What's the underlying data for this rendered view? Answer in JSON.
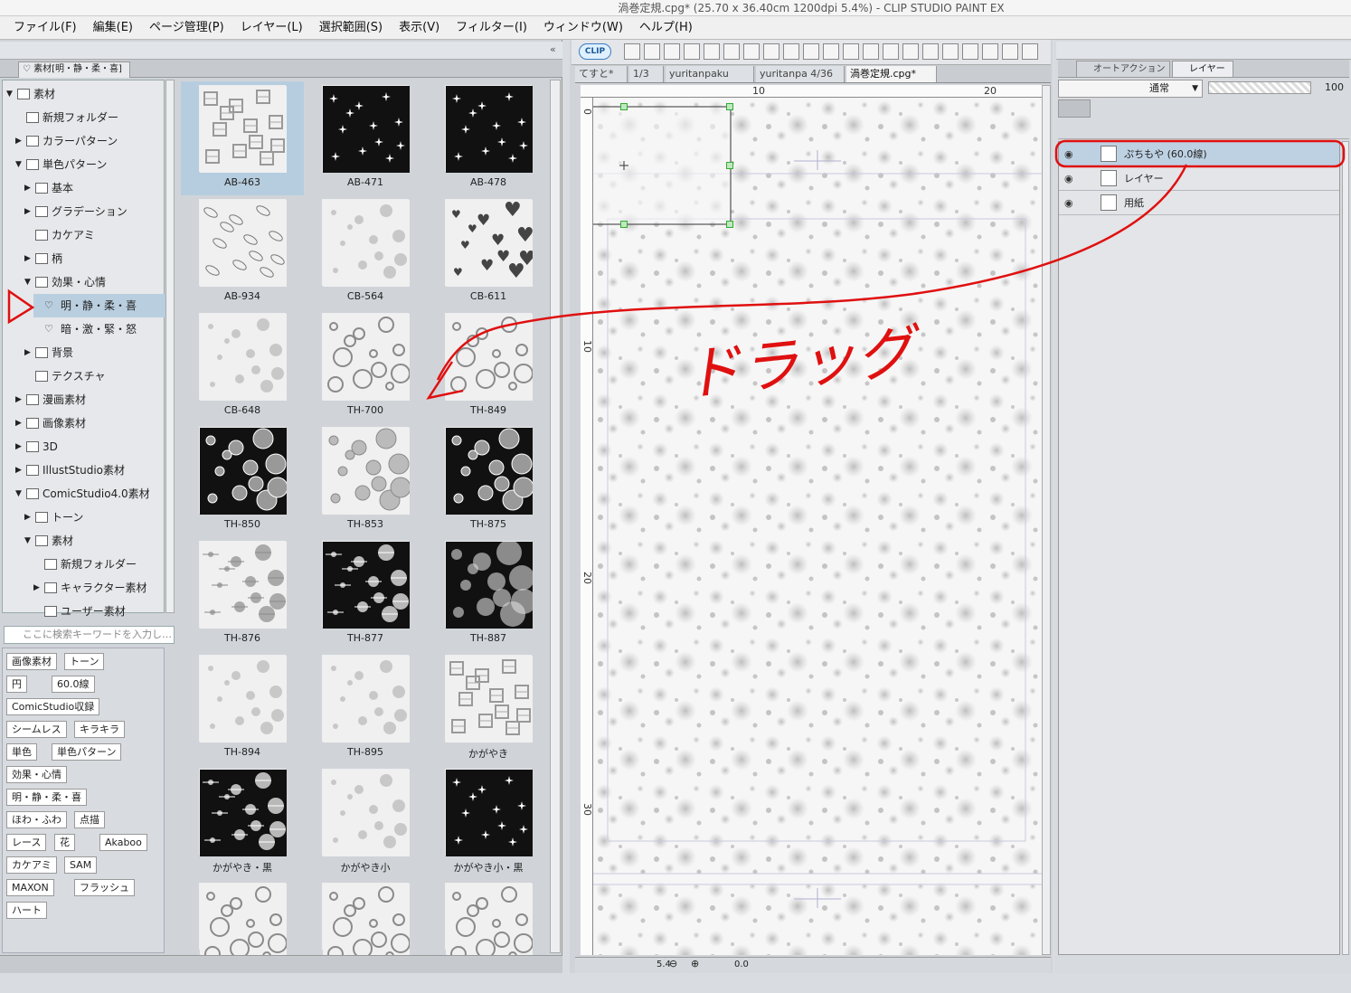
{
  "window": {
    "title": "渦巻定規.cpg* (25.70 x 36.40cm 1200dpi 5.4%)  - CLIP STUDIO PAINT EX"
  },
  "menu": [
    "ファイル(F)",
    "編集(E)",
    "ページ管理(P)",
    "レイヤー(L)",
    "選択範囲(S)",
    "表示(V)",
    "フィルター(I)",
    "ウィンドウ(W)",
    "ヘルプ(H)"
  ],
  "material_panel": {
    "tab_label": "素材[明・静・柔・喜]",
    "tree": [
      {
        "label": "素材",
        "level": 0,
        "arrow": "▼"
      },
      {
        "label": "新規フォルダー",
        "level": 1,
        "arrow": ""
      },
      {
        "label": "カラーパターン",
        "level": 1,
        "arrow": "▶"
      },
      {
        "label": "単色パターン",
        "level": 1,
        "arrow": "▼"
      },
      {
        "label": "基本",
        "level": 2,
        "arrow": "▶"
      },
      {
        "label": "グラデーション",
        "level": 2,
        "arrow": "▶"
      },
      {
        "label": "カケアミ",
        "level": 2,
        "arrow": ""
      },
      {
        "label": "柄",
        "level": 2,
        "arrow": "▶"
      },
      {
        "label": "効果・心情",
        "level": 2,
        "arrow": "▼"
      },
      {
        "label": "明・静・柔・喜",
        "level": 3,
        "arrow": "",
        "selected": true
      },
      {
        "label": "暗・激・緊・怒",
        "level": 3,
        "arrow": ""
      },
      {
        "label": "背景",
        "level": 2,
        "arrow": "▶"
      },
      {
        "label": "テクスチャ",
        "level": 2,
        "arrow": ""
      },
      {
        "label": "漫画素材",
        "level": 1,
        "arrow": "▶"
      },
      {
        "label": "画像素材",
        "level": 1,
        "arrow": "▶"
      },
      {
        "label": "3D",
        "level": 1,
        "arrow": "▶"
      },
      {
        "label": "IllustStudio素材",
        "level": 1,
        "arrow": "▶"
      },
      {
        "label": "ComicStudio4.0素材",
        "level": 1,
        "arrow": "▼"
      },
      {
        "label": "トーン",
        "level": 2,
        "arrow": "▶"
      },
      {
        "label": "素材",
        "level": 2,
        "arrow": "▼"
      },
      {
        "label": "新規フォルダー",
        "level": 3,
        "arrow": ""
      },
      {
        "label": "キャラクター素材",
        "level": 3,
        "arrow": "▶"
      },
      {
        "label": "ユーザー素材",
        "level": 3,
        "arrow": ""
      }
    ],
    "thumbnails": [
      {
        "label": "AB-463",
        "style": "cross",
        "dark": false,
        "selected": true
      },
      {
        "label": "AB-471",
        "style": "stars",
        "dark": true
      },
      {
        "label": "AB-478",
        "style": "stars",
        "dark": true
      },
      {
        "label": "AB-934",
        "style": "sketch",
        "dark": false
      },
      {
        "label": "CB-564",
        "style": "soft",
        "dark": false
      },
      {
        "label": "CB-611",
        "style": "hearts",
        "dark": false
      },
      {
        "label": "CB-648",
        "style": "soft",
        "dark": false
      },
      {
        "label": "TH-700",
        "style": "rings",
        "dark": false
      },
      {
        "label": "TH-849",
        "style": "rings",
        "dark": false
      },
      {
        "label": "TH-850",
        "style": "bubbles",
        "dark": true
      },
      {
        "label": "TH-853",
        "style": "bubbles",
        "dark": false
      },
      {
        "label": "TH-875",
        "style": "bubbles",
        "dark": true
      },
      {
        "label": "TH-876",
        "style": "sparkle",
        "dark": false
      },
      {
        "label": "TH-877",
        "style": "sparkle",
        "dark": true
      },
      {
        "label": "TH-887",
        "style": "bokeh",
        "dark": true
      },
      {
        "label": "TH-894",
        "style": "soft",
        "dark": false
      },
      {
        "label": "TH-895",
        "style": "soft",
        "dark": false
      },
      {
        "label": "かがやき",
        "style": "cross",
        "dark": false
      },
      {
        "label": "かがやき・黒",
        "style": "sparkle",
        "dark": true
      },
      {
        "label": "かがやき小",
        "style": "soft",
        "dark": false
      },
      {
        "label": "かがやき小・黒",
        "style": "stars",
        "dark": true
      }
    ],
    "search_placeholder": "ここに検索キーワードを入力し…",
    "tags": [
      "画像素材",
      "トーン",
      "円",
      "60.0線",
      "ComicStudio収録",
      "シームレス",
      "キラキラ",
      "単色",
      "単色パターン",
      "効果・心情",
      "明・静・柔・喜",
      "ほわ・ふわ",
      "点描",
      "レース",
      "花",
      "Akaboo",
      "カケアミ",
      "SAM",
      "MAXON",
      "フラッシュ",
      "ハート"
    ]
  },
  "canvas": {
    "doc_tabs": [
      {
        "label": "てすと*",
        "active": false
      },
      {
        "label": "1/3",
        "active": false
      },
      {
        "label": "yuritanpaku",
        "active": false
      },
      {
        "label": "yuritanpa 4/36",
        "active": false
      },
      {
        "label": "渦巻定規.cpg*",
        "active": true
      }
    ],
    "ruler_h": [
      "10",
      "20"
    ],
    "ruler_v": [
      "0",
      "10",
      "20",
      "30"
    ],
    "zoom": "5.4",
    "angle": "0.0"
  },
  "annotation": {
    "text": "ドラッグ",
    "color": "#e01010"
  },
  "layer_panel": {
    "tabs": [
      {
        "label": "オートアクション",
        "active": false
      },
      {
        "label": "レイヤー",
        "active": true
      }
    ],
    "blend_mode": "通常",
    "opacity": "100",
    "layers": [
      {
        "name": "ぷちもや (60.0線)",
        "selected": true
      },
      {
        "name": "レイヤー",
        "selected": false
      },
      {
        "name": "用紙",
        "selected": false
      }
    ]
  }
}
